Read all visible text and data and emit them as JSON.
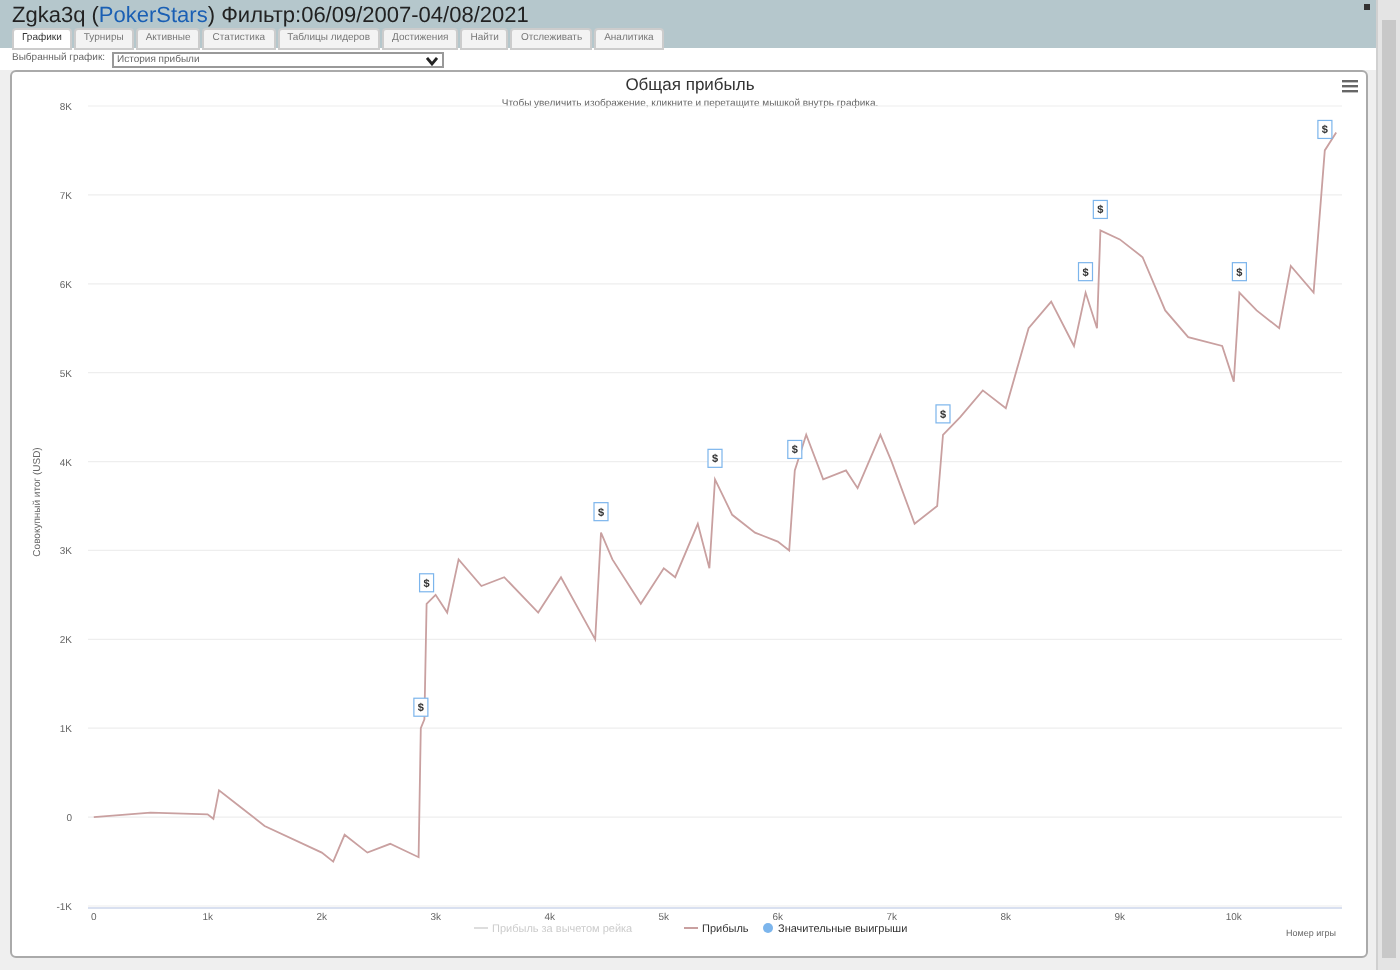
{
  "header": {
    "before": "Zgka3q (",
    "link": "PokerStars",
    "after": ") Фильтр:06/09/2007-04/08/2021"
  },
  "tabs": [
    {
      "label": "Графики",
      "selected": true
    },
    {
      "label": "Турниры",
      "selected": false
    },
    {
      "label": "Активные",
      "selected": false
    },
    {
      "label": "Статистика",
      "selected": false
    },
    {
      "label": "Таблицы лидеров",
      "selected": false
    },
    {
      "label": "Достижения",
      "selected": false
    },
    {
      "label": "Найти",
      "selected": false
    },
    {
      "label": "Отслеживать",
      "selected": false
    },
    {
      "label": "Аналитика",
      "selected": false
    }
  ],
  "graph_select": {
    "label": "Выбранный график:",
    "value": "История прибыли"
  },
  "chart": {
    "subtitle": "Чтобы увеличить изображение, кликните и перетащите мышкой внутрь графика.",
    "legend": [
      {
        "label": "Прибыль за вычетом рейка",
        "kind": "line",
        "hidden": true
      },
      {
        "kind": "series",
        "hidden": false
      },
      {
        "label": "Значительные выигрыши",
        "kind": "dot",
        "hidden": false,
        "color": "#7cb5ec"
      }
    ],
    "chart_data": {
      "type": "line",
      "title": "Общая прибыль",
      "xlabel": "Номер игры",
      "ylabel": "Совокупный итог (USD)",
      "x": [
        0,
        500,
        1000,
        1050,
        1100,
        1300,
        1500,
        2000,
        2100,
        2200,
        2400,
        2600,
        2850,
        2870,
        2900,
        2920,
        3000,
        3100,
        3200,
        3400,
        3600,
        3900,
        4100,
        4400,
        4450,
        4550,
        4800,
        5000,
        5100,
        5300,
        5400,
        5450,
        5600,
        5800,
        6000,
        6100,
        6150,
        6250,
        6400,
        6600,
        6700,
        6900,
        7000,
        7200,
        7400,
        7450,
        7600,
        7800,
        8000,
        8200,
        8400,
        8600,
        8700,
        8800,
        8830,
        9000,
        9200,
        9400,
        9600,
        9900,
        10000,
        10050,
        10200,
        10400,
        10500,
        10700,
        10800,
        10900
      ],
      "series": [
        {
          "name": "Прибыль",
          "color": "#c9a0a0",
          "values": [
            0,
            50,
            30,
            -20,
            300,
            100,
            -100,
            -400,
            -500,
            -200,
            -400,
            -300,
            -450,
            1000,
            1100,
            2400,
            2500,
            2300,
            2900,
            2600,
            2700,
            2300,
            2700,
            2000,
            3200,
            2900,
            2400,
            2800,
            2700,
            3300,
            2800,
            3800,
            3400,
            3200,
            3100,
            3000,
            3900,
            4300,
            3800,
            3900,
            3700,
            4300,
            4000,
            3300,
            3500,
            4300,
            4500,
            4800,
            4600,
            5500,
            5800,
            5300,
            5900,
            5500,
            6600,
            6500,
            6300,
            5700,
            5400,
            5300,
            4900,
            5900,
            5700,
            5500,
            6200,
            5900,
            7500,
            7700
          ]
        }
      ],
      "xlim": [
        -50,
        10950
      ],
      "ylim": [
        -1000,
        8000
      ],
      "grid": true,
      "xticks": [
        {
          "value": 0,
          "label": "0"
        },
        {
          "value": 1000,
          "label": "1k"
        },
        {
          "value": 2000,
          "label": "2k"
        },
        {
          "value": 3000,
          "label": "3k"
        },
        {
          "value": 4000,
          "label": "4k"
        },
        {
          "value": 5000,
          "label": "5k"
        },
        {
          "value": 6000,
          "label": "6k"
        },
        {
          "value": 7000,
          "label": "7k"
        },
        {
          "value": 8000,
          "label": "8k"
        },
        {
          "value": 9000,
          "label": "9k"
        },
        {
          "value": 10000,
          "label": "10k"
        }
      ],
      "yticks": [
        {
          "value": -1000,
          "label": "-1K"
        },
        {
          "value": 0,
          "label": "0"
        },
        {
          "value": 1000,
          "label": "1K"
        },
        {
          "value": 2000,
          "label": "2K"
        },
        {
          "value": 3000,
          "label": "3K"
        },
        {
          "value": 4000,
          "label": "4K"
        },
        {
          "value": 5000,
          "label": "5K"
        },
        {
          "value": 6000,
          "label": "6K"
        },
        {
          "value": 7000,
          "label": "7K"
        },
        {
          "value": 8000,
          "label": "8K"
        }
      ],
      "annotations": [
        {
          "x": 2870,
          "y": 1000,
          "text": "$"
        },
        {
          "x": 2920,
          "y": 2400,
          "text": "$"
        },
        {
          "x": 4450,
          "y": 3200,
          "text": "$"
        },
        {
          "x": 5450,
          "y": 3800,
          "text": "$"
        },
        {
          "x": 6150,
          "y": 3900,
          "text": "$"
        },
        {
          "x": 7450,
          "y": 4300,
          "text": "$"
        },
        {
          "x": 8700,
          "y": 5900,
          "text": "$"
        },
        {
          "x": 8830,
          "y": 6600,
          "text": "$"
        },
        {
          "x": 10050,
          "y": 5900,
          "text": "$"
        },
        {
          "x": 10800,
          "y": 7500,
          "text": "$"
        }
      ]
    }
  }
}
